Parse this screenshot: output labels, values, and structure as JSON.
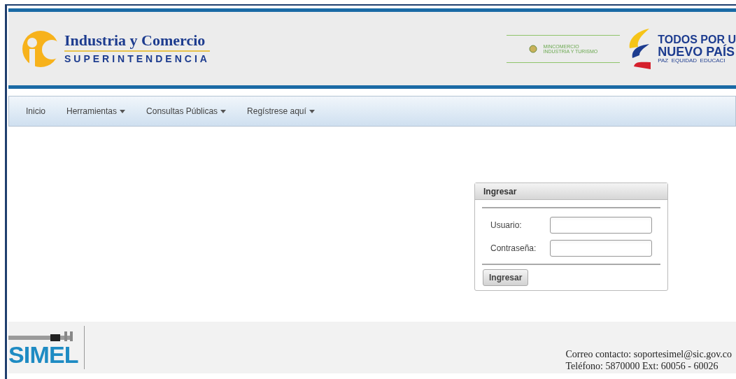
{
  "header": {
    "logo_title": "Industria y Comercio",
    "logo_subtitle": "SUPERINTENDENCIA",
    "ministry_line_1": "MINCOMERCIO",
    "ministry_line_2": "INDUSTRIA Y TURISMO",
    "slogan_line_1": "TODOS POR U",
    "slogan_line_2": "NUEVO PAÍS",
    "slogan_line_3": "PAZ  EQUIDAD  EDUCACI"
  },
  "nav": [
    {
      "label": "Inicio",
      "dropdown": false
    },
    {
      "label": "Herramientas",
      "dropdown": true
    },
    {
      "label": "Consultas Públicas",
      "dropdown": true
    },
    {
      "label": "Regístrese aquí",
      "dropdown": true
    }
  ],
  "login": {
    "title": "Ingresar",
    "fields": [
      {
        "label": "Usuario:"
      },
      {
        "label": "Contraseña:"
      }
    ],
    "button": "Ingresar"
  },
  "footer": {
    "logo_text": "SIMEL",
    "contact_lines": [
      "Correo contacto: soportesimel@sic.gov.co",
      "Teléfono: 5870000 Ext: 60056 - 60026"
    ]
  }
}
